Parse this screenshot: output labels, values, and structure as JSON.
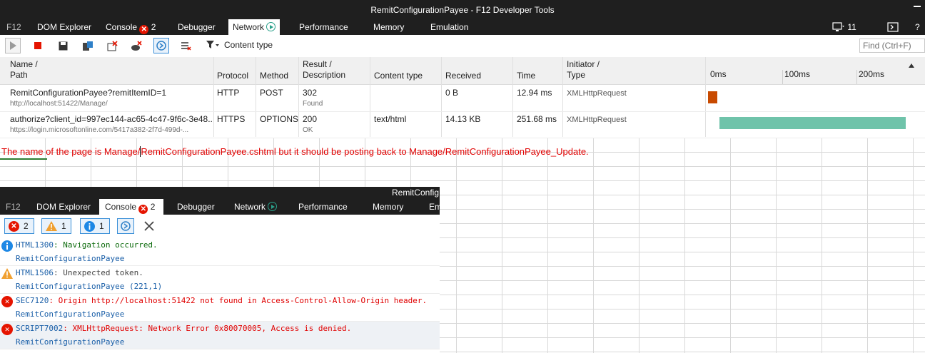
{
  "top_window": {
    "title": "RemitConfigurationPayee - F12 Developer Tools",
    "tabs": {
      "f12": "F12",
      "dom_explorer": "DOM Explorer",
      "console": "Console",
      "console_errors": "2",
      "debugger": "Debugger",
      "network": "Network",
      "performance": "Performance",
      "memory": "Memory",
      "emulation": "Emulation"
    },
    "right_controls": {
      "device_count": "11",
      "help": "?"
    },
    "toolbar": {
      "content_type_filter": "Content type",
      "find_placeholder": "Find (Ctrl+F)"
    },
    "table": {
      "headers": {
        "name": "Name /",
        "path": "Path",
        "protocol": "Protocol",
        "method": "Method",
        "result": "Result /",
        "description": "Description",
        "content_type": "Content type",
        "received": "Received",
        "time": "Time",
        "initiator": "Initiator /",
        "type": "Type",
        "timeline_0": "0ms",
        "timeline_100": "100ms",
        "timeline_200": "200ms"
      },
      "rows": [
        {
          "name": "RemitConfigurationPayee?remitItemID=1",
          "path": "http://localhost:51422/Manage/",
          "protocol": "HTTP",
          "method": "POST",
          "result": "302",
          "description": "Found",
          "content_type": "",
          "received": "0 B",
          "time": "12.94 ms",
          "initiator": "XMLHttpRequest",
          "timing_start_ms": 0,
          "timing_duration_ms": 12.94,
          "bar_color": "#c84a00"
        },
        {
          "name": "authorize?client_id=997ec144-ac65-4c47-9f6c-3e48...",
          "path": "https://login.microsoftonline.com/5417a382-2f7d-499d-...",
          "protocol": "HTTPS",
          "method": "OPTIONS",
          "result": "200",
          "description": "OK",
          "content_type": "text/html",
          "received": "14.13 KB",
          "time": "251.68 ms",
          "initiator": "XMLHttpRequest",
          "timing_start_ms": 15,
          "timing_duration_ms": 251.68,
          "bar_color": "#6fc3aa"
        }
      ]
    }
  },
  "annotation": {
    "text_before_cursor": "The name of the page is Manage/",
    "text_after_cursor": "RemitConfigurationPayee.cshtml but it should be posting back to Manage/RemitConfigurationPayee_Update."
  },
  "bottom_window": {
    "title": "RemitConfig",
    "tabs": {
      "f12": "F12",
      "dom_explorer": "DOM Explorer",
      "console": "Console",
      "console_errors": "2",
      "debugger": "Debugger",
      "network": "Network",
      "performance": "Performance",
      "memory": "Memory",
      "emulation_truncated": "Em"
    },
    "filters": {
      "errors": "2",
      "warnings": "1",
      "info": "1"
    },
    "messages": [
      {
        "kind": "info",
        "code": "HTML1300",
        "text": ": Navigation occurred.",
        "source": "RemitConfigurationPayee"
      },
      {
        "kind": "warning",
        "code": "HTML1506",
        "text": ": Unexpected token.",
        "source": "RemitConfigurationPayee (221,1)"
      },
      {
        "kind": "error",
        "code": "SEC7120",
        "text": ": Origin http://localhost:51422 not found in Access-Control-Allow-Origin header.",
        "source": "RemitConfigurationPayee"
      },
      {
        "kind": "error",
        "code": "SCRIPT7002",
        "text": ": XMLHttpRequest: Network Error 0x80070005, Access is denied.",
        "source": "RemitConfigurationPayee"
      }
    ]
  },
  "colors": {
    "chrome_dark": "#1f1f1f",
    "accent_blue": "#3a8fd8",
    "error_red": "#e51400",
    "warning_orange": "#f0a030",
    "info_blue": "#1e88e5",
    "annotation_red": "#e00000"
  }
}
